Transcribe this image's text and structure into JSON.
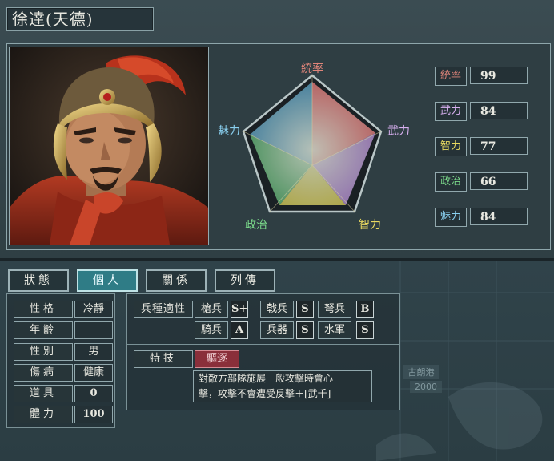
{
  "officer": {
    "name": "徐達(天德)"
  },
  "radar": {
    "labels": {
      "top": "統率",
      "right": "武力",
      "bottom_right": "智力",
      "bottom_left": "政治",
      "left": "魅力"
    },
    "label_colors": {
      "top": "#e0857a",
      "right": "#d8b0f0",
      "bottom_right": "#e8d860",
      "bottom_left": "#7ad88a",
      "left": "#8ad0f0"
    }
  },
  "stats": [
    {
      "label": "統率",
      "value": "99",
      "color": "#e0857a"
    },
    {
      "label": "武力",
      "value": "84",
      "color": "#d8b0f0"
    },
    {
      "label": "智力",
      "value": "77",
      "color": "#e8d860"
    },
    {
      "label": "政治",
      "value": "66",
      "color": "#7ad88a"
    },
    {
      "label": "魅力",
      "value": "84",
      "color": "#8ad0f0"
    }
  ],
  "tabs": [
    {
      "label": "狀態",
      "active": false
    },
    {
      "label": "個人",
      "active": true
    },
    {
      "label": "關係",
      "active": false
    },
    {
      "label": "列傳",
      "active": false
    }
  ],
  "personal": [
    {
      "label": "性格",
      "value": "冷靜"
    },
    {
      "label": "年齡",
      "value": "--"
    },
    {
      "label": "性別",
      "value": "男"
    },
    {
      "label": "傷病",
      "value": "健康"
    },
    {
      "label": "道具",
      "value": "0"
    },
    {
      "label": "體力",
      "value": "100"
    }
  ],
  "aptitude": {
    "title": "兵種適性",
    "units": [
      {
        "name": "槍兵",
        "grade": "S+"
      },
      {
        "name": "戟兵",
        "grade": "S"
      },
      {
        "name": "弩兵",
        "grade": "B"
      },
      {
        "name": "騎兵",
        "grade": "A"
      },
      {
        "name": "兵器",
        "grade": "S"
      },
      {
        "name": "水軍",
        "grade": "S"
      }
    ]
  },
  "skill": {
    "title": "特技",
    "name": "驅逐",
    "description_line1": "對敵方部隊施展一般攻擊時會心一",
    "description_line2": "擊，攻擊不會遭受反擊＋[武千]"
  },
  "background_map": {
    "place": "古朗港",
    "number": "2000"
  }
}
